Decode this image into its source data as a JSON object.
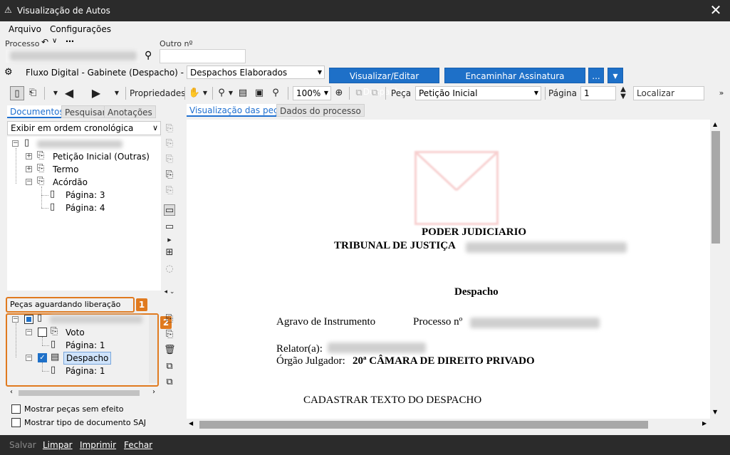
{
  "window": {
    "title": "Visualização de Autos",
    "close_glyph": "✕"
  },
  "menu": {
    "items": [
      "Arquivo",
      "Configurações"
    ]
  },
  "process": {
    "label": "Processo",
    "outro_label": "Outro nº",
    "outro_value": ""
  },
  "flow": {
    "label": "Fluxo Digital - Gabinete (Despacho) - Fila:",
    "queue_selected": "Despachos Elaborados",
    "btn_view_edit": "Visualizar/Editar Despacho",
    "btn_forward": "Encaminhar Assinatura Magistrado",
    "btn_more": "...",
    "btn_down": "▾"
  },
  "toolbar": {
    "properties": "Propriedades",
    "zoom": "100%",
    "peca_label": "Peça",
    "peca_value": "Petição Inicial",
    "pagina_label": "Página",
    "pagina_value": "1",
    "localizar_placeholder": "Localizar"
  },
  "left_tabs": [
    "Documentos",
    "Pesquisar",
    "Anotações"
  ],
  "order_select": "Exibir em ordem cronológica",
  "tree_top": [
    {
      "label": "Petição Inicial (Outras)"
    },
    {
      "label": "Termo"
    },
    {
      "label": "Acórdão"
    },
    {
      "label": "Página: 3"
    },
    {
      "label": "Página: 4"
    }
  ],
  "pending": {
    "title": "Peças aguardando liberação",
    "badge1": "1",
    "badge2": "2",
    "items": [
      {
        "label": "Voto"
      },
      {
        "label": "Página: 1"
      },
      {
        "label": "Despacho"
      },
      {
        "label": "Página: 1"
      }
    ]
  },
  "options": {
    "show_no_effect": "Mostrar peças sem efeito",
    "show_saj_type": "Mostrar tipo de documento SAJ"
  },
  "right_tabs": [
    "Visualização das peças",
    "Dados do processo"
  ],
  "document": {
    "line1": "PODER JUDICIARIO",
    "line2": "TRIBUNAL DE JUSTIÇA",
    "heading": "Despacho",
    "agravo": "Agravo de Instrumento",
    "processo": "Processo nº",
    "relator": "Relator(a):",
    "orgao_label": "Órgão Julgador:",
    "orgao_value": "20ª CÂMARA DE DIREITO PRIVADO",
    "body": "CADASTRAR TEXTO DO DESPACHO"
  },
  "status": {
    "salvar": "Salvar",
    "limpar": "Limpar",
    "imprimir": "Imprimir",
    "fechar": "Fechar"
  },
  "colors": {
    "accent": "#1e70c8",
    "highlight": "#e07a1f",
    "dark": "#2b2b2b"
  }
}
